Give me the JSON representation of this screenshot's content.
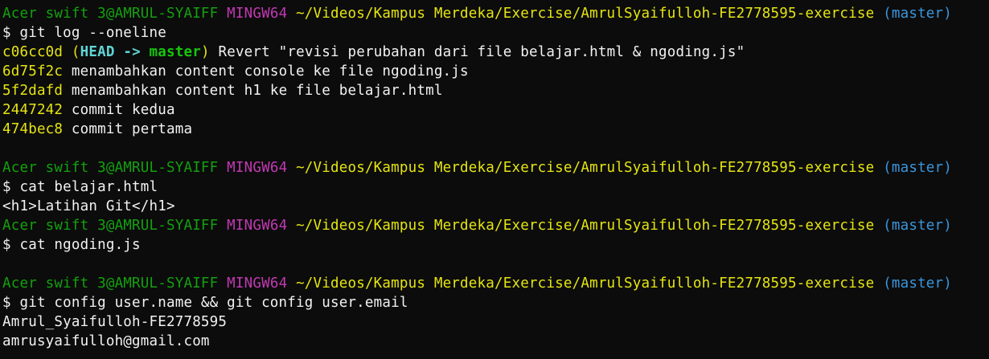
{
  "colors": {
    "background": "#0c0c0c",
    "text": "#f2f2f2",
    "user": "#13a10e",
    "mingw": "#c239b3",
    "path": "#e5e510",
    "branch": "#3a96dd",
    "head": "#61d6d6",
    "hash": "#e5e510"
  },
  "prompts": [
    {
      "user": "Acer swift 3@AMRUL-SYAIFF",
      "env": "MINGW64",
      "path": "~/Videos/Kampus Merdeka/Exercise/AmrulSyaifulloh-FE2778595-exercise",
      "branch": "(master)"
    }
  ],
  "blocks": {
    "b1": {
      "command": "$ git log --oneline",
      "commits": [
        {
          "hash": "c06cc0d",
          "head": "HEAD ->",
          "ref": "master",
          "message": "Revert \"revisi perubahan dari file belajar.html & ngoding.js\""
        },
        {
          "hash": "6d75f2c",
          "message": "menambahkan content console ke file ngoding.js"
        },
        {
          "hash": "5f2dafd",
          "message": "menambahkan content h1 ke file belajar.html"
        },
        {
          "hash": "2447242",
          "message": "commit kedua"
        },
        {
          "hash": "474bec8",
          "message": "commit pertama"
        }
      ]
    },
    "b2": {
      "command": "$ cat belajar.html",
      "output": "<h1>Latihan Git</h1>"
    },
    "b3": {
      "command": "$ cat ngoding.js"
    },
    "b4": {
      "command": "$ git config user.name && git config user.email",
      "output1": "Amrul_Syaifulloh-FE2778595",
      "output2": "amrusyaifulloh@gmail.com"
    }
  }
}
